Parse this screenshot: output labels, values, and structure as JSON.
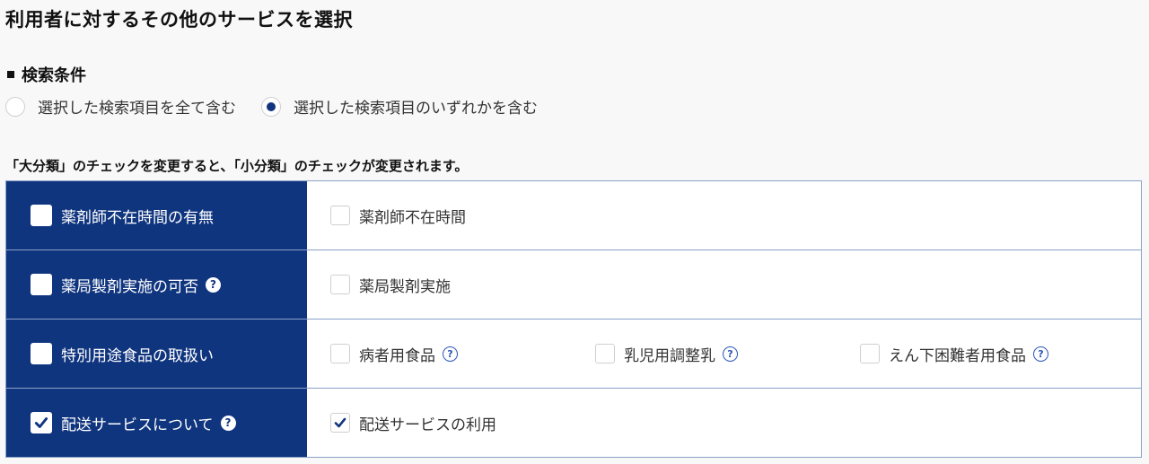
{
  "page_title": "利用者に対するその他のサービスを選択",
  "search_conditions": {
    "title": "検索条件",
    "options": [
      {
        "label": "選択した検索項目を全て含む",
        "selected": false
      },
      {
        "label": "選択した検索項目のいずれかを含む",
        "selected": true
      }
    ]
  },
  "note": "「大分類」のチェックを変更すると、「小分類」のチェックが変更されます。",
  "categories": [
    {
      "label": "薬剤師不在時間の有無",
      "checked": false,
      "help": false,
      "items": [
        {
          "label": "薬剤師不在時間",
          "checked": false,
          "help": false
        }
      ]
    },
    {
      "label": "薬局製剤実施の可否",
      "checked": false,
      "help": true,
      "items": [
        {
          "label": "薬局製剤実施",
          "checked": false,
          "help": false
        }
      ]
    },
    {
      "label": "特別用途食品の取扱い",
      "checked": false,
      "help": false,
      "items": [
        {
          "label": "病者用食品",
          "checked": false,
          "help": true
        },
        {
          "label": "乳児用調整乳",
          "checked": false,
          "help": true
        },
        {
          "label": "えん下困難者用食品",
          "checked": false,
          "help": true
        }
      ]
    },
    {
      "label": "配送サービスについて",
      "checked": true,
      "help": true,
      "items": [
        {
          "label": "配送サービスの利用",
          "checked": true,
          "help": false
        }
      ]
    }
  ],
  "colors": {
    "navy": "#10357f",
    "border": "#8aa0c8"
  }
}
